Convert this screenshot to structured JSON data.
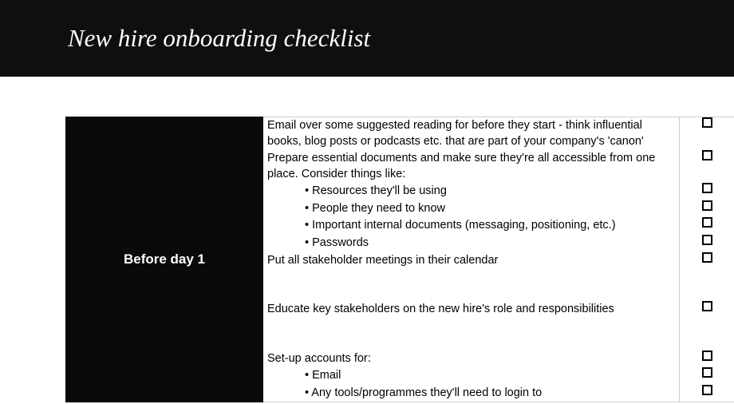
{
  "header": {
    "title": "New hire onboarding checklist"
  },
  "section": {
    "label": "Before day 1"
  },
  "tasks": [
    {
      "text": "Email over some suggested reading for before they start - think influential books, blog posts or podcasts etc. that are part of your company's 'canon'",
      "bullet": false,
      "checkbox": true
    },
    {
      "text": "Prepare essential documents and make sure they're all accessible from one place. Consider things like:",
      "bullet": false,
      "checkbox": true
    },
    {
      "text": "• Resources they'll be using",
      "bullet": true,
      "checkbox": true
    },
    {
      "text": "• People they need to know",
      "bullet": true,
      "checkbox": true
    },
    {
      "text": "• Important internal documents (messaging, positioning, etc.)",
      "bullet": true,
      "checkbox": true
    },
    {
      "text": "• Passwords",
      "bullet": true,
      "checkbox": true
    },
    {
      "text": "Put all stakeholder meetings in their calendar",
      "bullet": false,
      "checkbox": true
    },
    {
      "text": "",
      "bullet": false,
      "checkbox": false,
      "spacer": true
    },
    {
      "text": "Educate key stakeholders on the new hire's role and responsibilities",
      "bullet": false,
      "checkbox": true
    },
    {
      "text": "",
      "bullet": false,
      "checkbox": false,
      "spacer": true
    },
    {
      "text": "Set-up accounts for:",
      "bullet": false,
      "checkbox": true
    },
    {
      "text": "• Email",
      "bullet": true,
      "checkbox": true
    },
    {
      "text": "• Any tools/programmes they'll need to login to",
      "bullet": true,
      "checkbox": true
    }
  ]
}
